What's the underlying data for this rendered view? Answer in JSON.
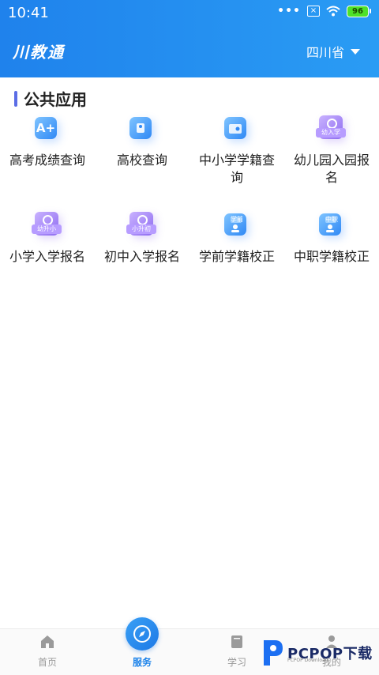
{
  "status_bar": {
    "time": "10:41",
    "dots": "•••",
    "battery": "96"
  },
  "header": {
    "app_title": "川教通",
    "province": "四川省"
  },
  "section": {
    "title": "公共应用"
  },
  "apps": [
    {
      "label": "高考成绩查询",
      "icon": "score-query-icon",
      "glyph": "A+"
    },
    {
      "label": "高校查询",
      "icon": "university-query-icon",
      "glyph": ""
    },
    {
      "label": "中小学学籍查询",
      "icon": "student-status-query-icon",
      "glyph": ""
    },
    {
      "label": "幼儿园入园报名",
      "icon": "kindergarten-enroll-icon",
      "tag": "幼入学"
    },
    {
      "label": "小学入学报名",
      "icon": "primary-enroll-icon",
      "tag": "幼升小"
    },
    {
      "label": "初中入学报名",
      "icon": "junior-enroll-icon",
      "tag": "小升初"
    },
    {
      "label": "学前学籍校正",
      "icon": "preschool-status-correct-icon",
      "tag": "学前"
    },
    {
      "label": "中职学籍校正",
      "icon": "vocational-status-correct-icon",
      "tag": "中职"
    }
  ],
  "tabbar": {
    "tabs": [
      {
        "label": "首页",
        "icon": "home-icon"
      },
      {
        "label": "服务",
        "icon": "compass-icon"
      },
      {
        "label": "学习",
        "icon": "book-icon"
      },
      {
        "label": "我的",
        "icon": "user-icon"
      }
    ]
  },
  "watermark": {
    "brand": "PCPOP下载",
    "sub": "PCPOP Download"
  },
  "colors": {
    "accent": "#1c83ea",
    "header_start": "#1f82ec",
    "header_end": "#2a9cf4",
    "section_bar": "#5b6de6"
  }
}
